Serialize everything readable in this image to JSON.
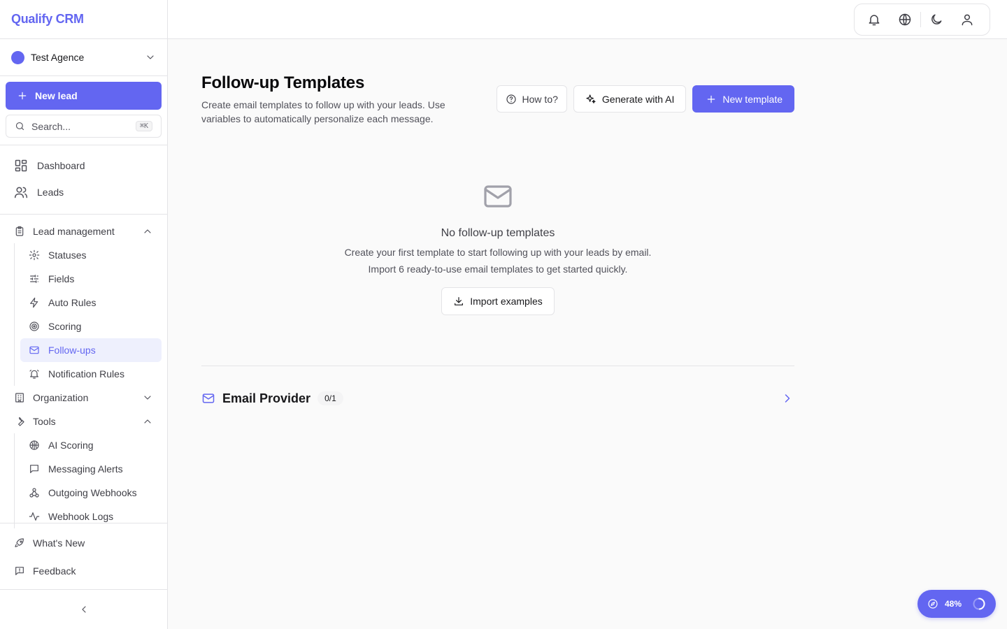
{
  "brand": {
    "name": "Qualify CRM",
    "color": "#6366f1"
  },
  "org": {
    "name": "Test Agence",
    "icon": "chevron-down-icon"
  },
  "sidebar": {
    "new_lead_label": "New lead",
    "search_placeholder": "Search...",
    "search_shortcut": "⌘K",
    "top_items": [
      {
        "label": "Dashboard",
        "icon": "dashboard-icon"
      },
      {
        "label": "Leads",
        "icon": "users-icon"
      }
    ],
    "lead_management": {
      "label": "Lead management",
      "expanded": true,
      "items": [
        {
          "label": "Statuses",
          "icon": "gear-icon"
        },
        {
          "label": "Fields",
          "icon": "sliders-icon"
        },
        {
          "label": "Auto Rules",
          "icon": "zap-icon"
        },
        {
          "label": "Scoring",
          "icon": "target-icon"
        },
        {
          "label": "Follow-ups",
          "icon": "mail-icon",
          "active": true
        },
        {
          "label": "Notification Rules",
          "icon": "bell-ring-icon"
        }
      ]
    },
    "organization": {
      "label": "Organization",
      "expanded": false
    },
    "tools": {
      "label": "Tools",
      "expanded": true,
      "items": [
        {
          "label": "AI Scoring",
          "icon": "brain-icon"
        },
        {
          "label": "Messaging Alerts",
          "icon": "message-icon"
        },
        {
          "label": "Outgoing Webhooks",
          "icon": "webhook-icon"
        },
        {
          "label": "Webhook Logs",
          "icon": "activity-icon"
        }
      ]
    },
    "bottom": [
      {
        "label": "What's New",
        "icon": "rocket-icon"
      },
      {
        "label": "Feedback",
        "icon": "feedback-icon"
      }
    ]
  },
  "topbar": {
    "icons": [
      "bell-icon",
      "globe-icon",
      "moon-icon",
      "user-icon"
    ]
  },
  "page": {
    "title": "Follow-up Templates",
    "description": "Create email templates to follow up with your leads. Use variables to automatically personalize each message.",
    "actions": {
      "how_to": "How to?",
      "generate_ai": "Generate with AI",
      "new_template": "New template"
    },
    "empty": {
      "title": "No follow-up templates",
      "line1": "Create your first template to start following up with your leads by email.",
      "line2": "Import 6 ready-to-use email templates to get started quickly.",
      "import_label": "Import examples"
    },
    "email_provider": {
      "title": "Email Provider",
      "count": "0/1"
    }
  },
  "progress": {
    "value": 48,
    "label": "48%"
  }
}
